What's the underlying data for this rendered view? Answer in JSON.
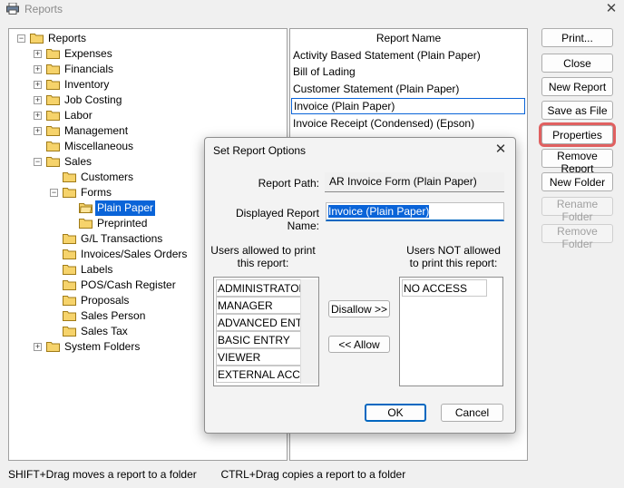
{
  "window": {
    "title": "Reports",
    "icon": "printer-icon"
  },
  "tree": {
    "root": "Reports",
    "items": [
      {
        "label": "Expenses"
      },
      {
        "label": "Financials"
      },
      {
        "label": "Inventory"
      },
      {
        "label": "Job Costing"
      },
      {
        "label": "Labor"
      },
      {
        "label": "Management"
      },
      {
        "label": "Miscellaneous"
      },
      {
        "label": "Sales"
      },
      {
        "label": "Customers"
      },
      {
        "label": "Forms"
      },
      {
        "label": "Plain Paper"
      },
      {
        "label": "Preprinted"
      },
      {
        "label": "G/L Transactions"
      },
      {
        "label": "Invoices/Sales Orders"
      },
      {
        "label": "Labels"
      },
      {
        "label": "POS/Cash Register"
      },
      {
        "label": "Proposals"
      },
      {
        "label": "Sales Person"
      },
      {
        "label": "Sales Tax"
      },
      {
        "label": "System Folders"
      }
    ]
  },
  "report_list": {
    "header": "Report Name",
    "rows": [
      "Activity Based Statement (Plain Paper)",
      "Bill of Lading",
      "Customer Statement (Plain Paper)",
      "Invoice (Plain Paper)",
      "Invoice Receipt (Condensed) (Epson)"
    ]
  },
  "buttons": {
    "print": "Print...",
    "close": "Close",
    "new_report": "New Report",
    "save_as_file": "Save as File",
    "properties": "Properties",
    "remove_report": "Remove Report",
    "new_folder": "New Folder",
    "rename_folder": "Rename Folder",
    "remove_folder": "Remove Folder"
  },
  "status": {
    "shift_hint": "SHIFT+Drag moves a report to a folder",
    "ctrl_hint": "CTRL+Drag copies a report to a folder"
  },
  "dialog": {
    "title": "Set Report Options",
    "report_path_label": "Report Path:",
    "report_path_value": "AR Invoice Form (Plain Paper)",
    "displayed_name_label": "Displayed Report Name:",
    "displayed_name_value": "Invoice (Plain Paper)",
    "allowed_label_1": "Users allowed to print",
    "allowed_label_2": "this report:",
    "not_allowed_label_1": "Users NOT allowed",
    "not_allowed_label_2": "to print this report:",
    "allowed_users": [
      "ADMINISTRATOR",
      "MANAGER",
      "ADVANCED ENTRY",
      "BASIC ENTRY",
      "VIEWER",
      "EXTERNAL ACCES"
    ],
    "not_allowed_users": [
      "NO ACCESS"
    ],
    "disallow_button": "Disallow >>",
    "allow_button": "<< Allow",
    "ok_button": "OK",
    "cancel_button": "Cancel"
  }
}
